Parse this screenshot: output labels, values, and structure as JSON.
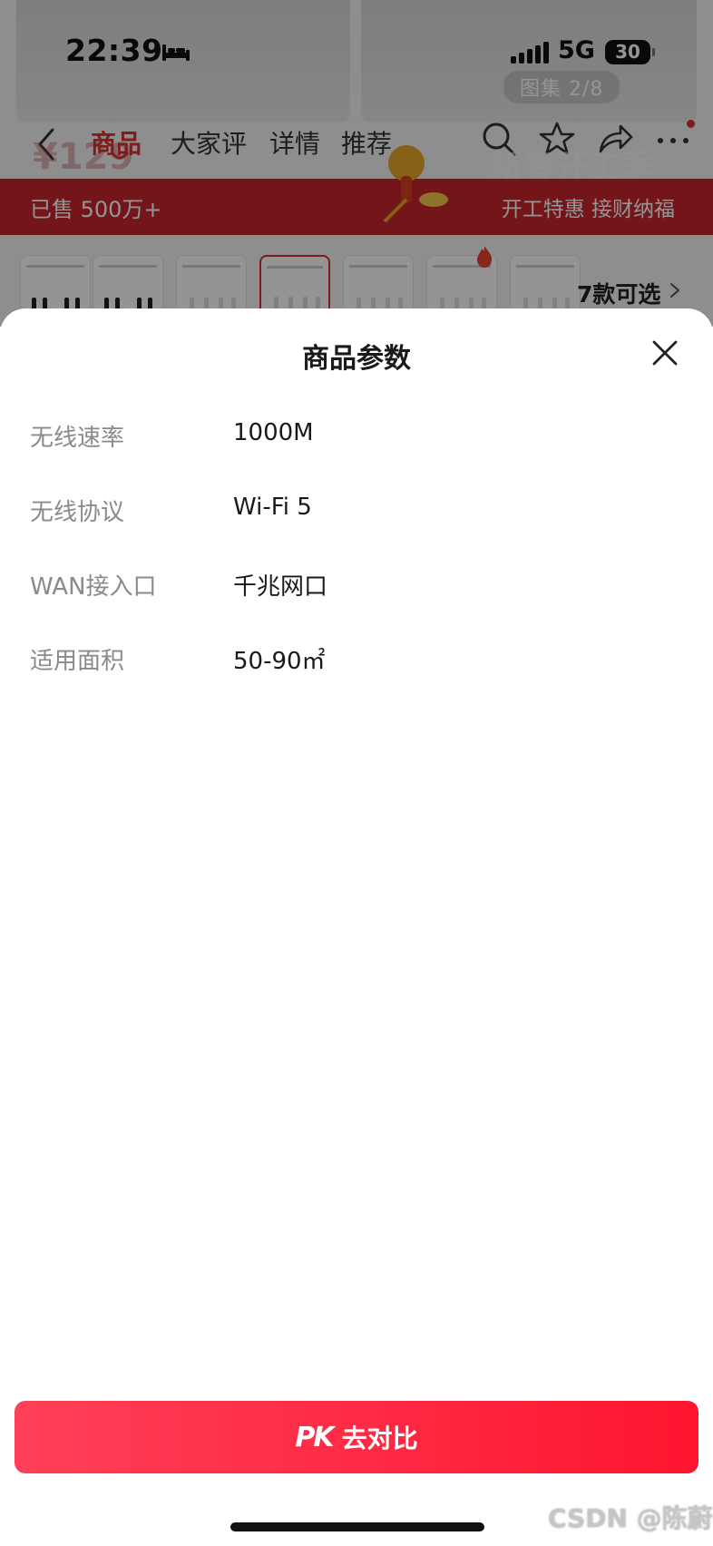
{
  "status_bar": {
    "time": "22:39",
    "network": "5G",
    "battery": "30",
    "icons": [
      "bed-icon",
      "signal-icon",
      "battery-icon"
    ]
  },
  "gallery": {
    "count": "图集 2/8"
  },
  "nav": {
    "tabs": [
      {
        "label": "商品",
        "active": true
      },
      {
        "label": "大家评",
        "active": false
      },
      {
        "label": "详情",
        "active": false
      },
      {
        "label": "推荐",
        "active": false
      }
    ],
    "icons": [
      "back-icon",
      "search-icon",
      "favorite-icon",
      "share-icon",
      "more-icon"
    ],
    "accent_color": "#e0302f"
  },
  "promo": {
    "sold": "已售 500万+",
    "slogan": "开工特惠 接财纳福",
    "price_ghost": "¥129",
    "ghost_title": "新春开工季",
    "bar_color": "#c6252b"
  },
  "variants": {
    "count_label": "7款可选",
    "selected_index": 3
  },
  "sheet": {
    "title": "商品参数",
    "params": [
      {
        "label": "无线速率",
        "value": "1000M"
      },
      {
        "label": "无线协议",
        "value": "Wi-Fi 5"
      },
      {
        "label": "WAN接入口",
        "value": "千兆网口"
      },
      {
        "label": "适用面积",
        "value": "50-90㎡"
      }
    ]
  },
  "footer": {
    "pk_logo": "PK",
    "pk_label": "去对比",
    "button_colors": [
      "#ff4058",
      "#ff1530"
    ]
  },
  "watermark": "CSDN @陈蔚"
}
